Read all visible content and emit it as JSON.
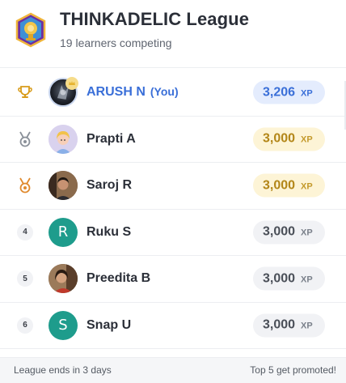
{
  "header": {
    "title": "THINKADELIC League",
    "subtitle": "19 learners competing",
    "badge_icon": "league-trophy-badge-icon"
  },
  "leaderboard": [
    {
      "rank": 1,
      "rank_icon": "trophy-icon",
      "name": "ARUSH N",
      "you_tag": "(You)",
      "xp": "3,206",
      "xp_unit": "XP",
      "pill": "blue",
      "avatar": "photo-dark-portrait",
      "has_crown": true
    },
    {
      "rank": 2,
      "rank_icon": "silver-medal-icon",
      "name": "Prapti A",
      "xp": "3,000",
      "xp_unit": "XP",
      "pill": "gold",
      "avatar": "illustrated-girl"
    },
    {
      "rank": 3,
      "rank_icon": "bronze-medal-icon",
      "name": "Saroj R",
      "xp": "3,000",
      "xp_unit": "XP",
      "pill": "gold",
      "avatar": "photo-man"
    },
    {
      "rank": "4",
      "name": "Ruku S",
      "xp": "3,000",
      "xp_unit": "XP",
      "pill": "gray",
      "avatar_letter": "R",
      "avatar_color": "#1e9c8c"
    },
    {
      "rank": "5",
      "name": "Preedita B",
      "xp": "3,000",
      "xp_unit": "XP",
      "pill": "gray",
      "avatar": "photo-woman"
    },
    {
      "rank": "6",
      "name": "Snap U",
      "xp": "3,000",
      "xp_unit": "XP",
      "pill": "gray",
      "avatar_letter": "S",
      "avatar_color": "#1e9c8c"
    }
  ],
  "footer": {
    "left": "League ends in 3 days",
    "right": "Top 5 get promoted!"
  },
  "colors": {
    "you_blue": "#3a6fd8",
    "gold_pill": "#fdf4d6",
    "teal_avatar": "#1e9c8c"
  }
}
